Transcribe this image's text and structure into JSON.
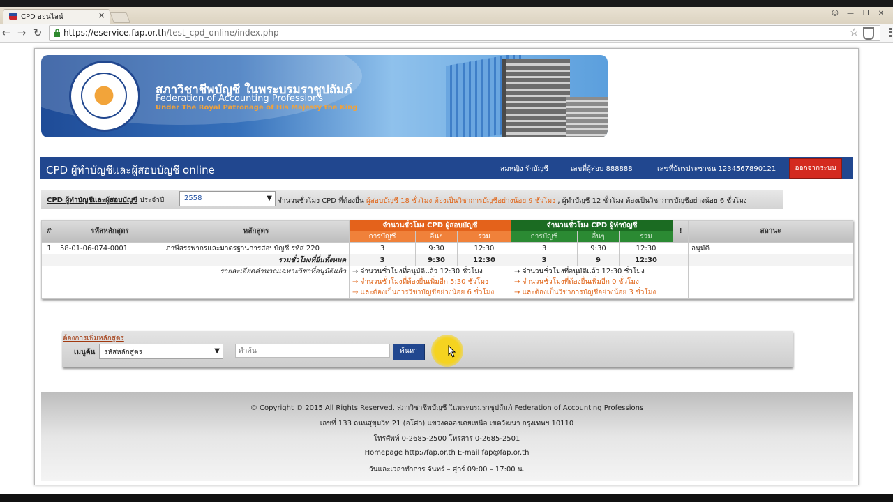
{
  "browser": {
    "tab_title": "CPD ออนไลน์",
    "url_host": "https://eservice.fap.or.th",
    "url_path": "/test_cpd_online/index.php"
  },
  "banner": {
    "org_name_th": "สภาวิชาชีพบัญชี ในพระบรมราชูปถัมภ์",
    "org_name_en": "Federation of Accounting Professions",
    "org_sub_en": "Under The Royal Patronage of His Majesty the King"
  },
  "header": {
    "title": "CPD ผู้ทำบัญชีและผู้สอบบัญชี online",
    "user_name": "สมหญิง รักบัญชี",
    "exam_no": "เลขที่ผู้สอบ 888888",
    "id_card": "เลขที่บัตรประชาชน 1234567890121",
    "logout_label": "ออกจากระบบ"
  },
  "filter": {
    "label_link": "CPD ผู้ทำบัญชีและผู้สอบบัญชี",
    "label_suffix": " ประจำปี",
    "year_value": "2558",
    "note_prefix": "จำนวนชั่วโมง CPD ที่ต้องยื่น ",
    "note_auditor": "ผู้สอบบัญชี 18 ชั่วโมง ต้องเป็นวิชาการบัญชีอย่างน้อย 9 ชั่วโมง",
    "note_accountant": " , ผู้ทำบัญชี 12 ชั่วโมง ต้องเป็นวิชาการบัญชีอย่างน้อย 6 ชั่วโมง"
  },
  "table": {
    "col_no": "#",
    "col_code": "รหัสหลักสูตร",
    "col_course": "หลักสูตร",
    "col_auditor_group": "จำนวนชั่วโมง CPD ผู้สอบบัญชี",
    "col_accountant_group": "จำนวนชั่วโมง CPD ผู้ทำบัญชี",
    "sub_accounting": "การบัญชี",
    "sub_other": "อื่นๆ",
    "sub_total": "รวม",
    "col_flag": "!",
    "col_status": "สถานะ",
    "rows": [
      {
        "no": "1",
        "code": "58-01-06-074-0001",
        "course": "ภาษีสรรพากรและมาตรฐานการสอบบัญชี รหัส 220",
        "aud_acc": "3",
        "aud_other": "9:30",
        "aud_total": "12:30",
        "acc_acc": "3",
        "acc_other": "9:30",
        "acc_total": "12:30",
        "status": "อนุมัติ"
      }
    ],
    "summary": {
      "label": "รวมชั่วโมงที่ยื่นทั้งหมด",
      "aud_acc": "3",
      "aud_other": "9:30",
      "aud_total": "12:30",
      "acc_acc": "3",
      "acc_other": "9",
      "acc_total": "12:30"
    },
    "detail": {
      "label": "รายละเอียดคำนวณเฉพาะวิชาที่อนุมัติแล้ว",
      "auditor_lines": [
        "→ จำนวนชั่วโมงที่อนุมัติแล้ว 12:30 ชั่วโมง",
        "→ จำนวนชั่วโมงที่ต้องยื่นเพิ่มอีก 5:30 ชั่วโมง",
        "→ และต้องเป็นการวิชาบัญชีอย่างน้อย 6 ชั่วโมง"
      ],
      "accountant_lines": [
        "→ จำนวนชั่วโมงที่อนุมัติแล้ว 12:30 ชั่วโมง",
        "→ จำนวนชั่วโมงที่ต้องยื่นเพิ่มอีก 0 ชั่วโมง",
        "→ และต้องเป็นวิชาการบัญชีอย่างน้อย 3 ชั่วโมง"
      ]
    }
  },
  "add_course": {
    "link": "ต้องการเพิ่มหลักสูตร",
    "search_label": "เมนูค้น",
    "search_by": "รหัสหลักสูตร",
    "keyword_placeholder": "คำค้น",
    "search_button": "ค้นหา"
  },
  "footer": {
    "copyright": "© Copyright © 2015 All Rights Reserved. สภาวิชาชีพบัญชี ในพระบรมราชูปถัมภ์ Federation of Accounting Professions",
    "address": "เลขที่ 133 ถนนสุขุมวิท 21 (อโศก) แขวงคลองเตยเหนือ เขตวัฒนา กรุงเทพฯ 10110",
    "phone": "โทรศัพท์ 0-2685-2500 โทรสาร 0-2685-2501",
    "web": "Homepage http://fap.or.th E-mail fap@fap.or.th",
    "hours": "วันและเวลาทำการ จันทร์ – ศุกร์ 09:00 – 17:00 น."
  },
  "colors": {
    "header_blue": "#21478f",
    "logout_red": "#d42a1f",
    "auditor_orange": "#e4621b",
    "accountant_green": "#1b6b22"
  }
}
